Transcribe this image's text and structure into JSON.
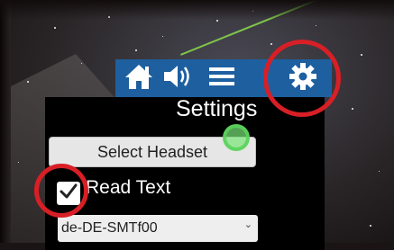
{
  "toolbar": {
    "home_icon": "home-icon",
    "sound_icon": "speaker-icon",
    "menu_icon": "menu-icon",
    "settings_icon": "gear-icon"
  },
  "settings": {
    "title": "Settings",
    "select_headset_label": "Select Headset",
    "read_text_label": "Read Text",
    "read_text_checked": true,
    "voice_value": "de-DE-SMTf00"
  },
  "colors": {
    "toolbar": "#1e5fa0",
    "highlight": "#d81f26",
    "gaze": "#78e678"
  }
}
